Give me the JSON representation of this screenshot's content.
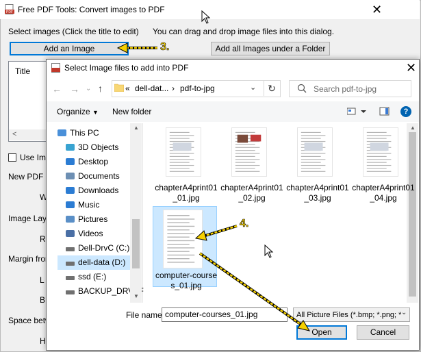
{
  "background_window": {
    "title": "Free PDF Tools: Convert images to PDF",
    "select_images_label": "Select images (Click the title to edit)",
    "drag_drop_hint": "You can drag and drop image files into this dialog.",
    "add_image_button": "Add an Image",
    "add_folder_button": "Add all Images under a Folder",
    "list_header_title": "Title",
    "use_image_label": "Use Ima",
    "new_pdf_label": "New PDF F",
    "w_label": "W",
    "image_layout_label": "Image Layo",
    "r_label": "R",
    "margin_label": "Margin fron",
    "l_label": "L",
    "b_label": "B",
    "space_label": "Space betw",
    "h_label": "H"
  },
  "dialog": {
    "title": "Select Image files to add into PDF",
    "breadcrumb": [
      "dell-dat...",
      "pdf-to-jpg"
    ],
    "breadcrumb_overflow": "«",
    "search_placeholder": "Search pdf-to-jpg",
    "organize_label": "Organize",
    "new_folder_label": "New folder",
    "tree": [
      {
        "label": "This PC",
        "icon": "pc-icon"
      },
      {
        "label": "3D Objects",
        "icon": "3d-objects-icon"
      },
      {
        "label": "Desktop",
        "icon": "desktop-icon"
      },
      {
        "label": "Documents",
        "icon": "documents-icon"
      },
      {
        "label": "Downloads",
        "icon": "downloads-icon"
      },
      {
        "label": "Music",
        "icon": "music-icon"
      },
      {
        "label": "Pictures",
        "icon": "pictures-icon"
      },
      {
        "label": "Videos",
        "icon": "videos-icon"
      },
      {
        "label": "Dell-DrvC (C:)",
        "icon": "drive-icon"
      },
      {
        "label": "dell-data (D:)",
        "icon": "drive-icon"
      },
      {
        "label": "ssd (E:)",
        "icon": "drive-icon"
      },
      {
        "label": "BACKUP_DRV (F",
        "icon": "drive-icon"
      }
    ],
    "files": [
      {
        "line1": "chapterA4print01",
        "line2": "_01.jpg"
      },
      {
        "line1": "chapterA4print01",
        "line2": "_02.jpg"
      },
      {
        "line1": "chapterA4print01",
        "line2": "_03.jpg"
      },
      {
        "line1": "chapterA4print01",
        "line2": "_04.jpg"
      },
      {
        "line1": "computer-course",
        "line2": "s_01.jpg"
      }
    ],
    "file_name_label": "File name:",
    "file_name_value": "computer-courses_01.jpg",
    "file_type_value": "All Picture Files (*.bmp; *.png; *",
    "open_button": "Open",
    "cancel_button": "Cancel"
  },
  "annotations": {
    "step3": "3.",
    "step4": "4."
  },
  "colors": {
    "selection": "#cce8ff",
    "annotation_yellow": "#f5d000",
    "accent": "#0078d7"
  }
}
